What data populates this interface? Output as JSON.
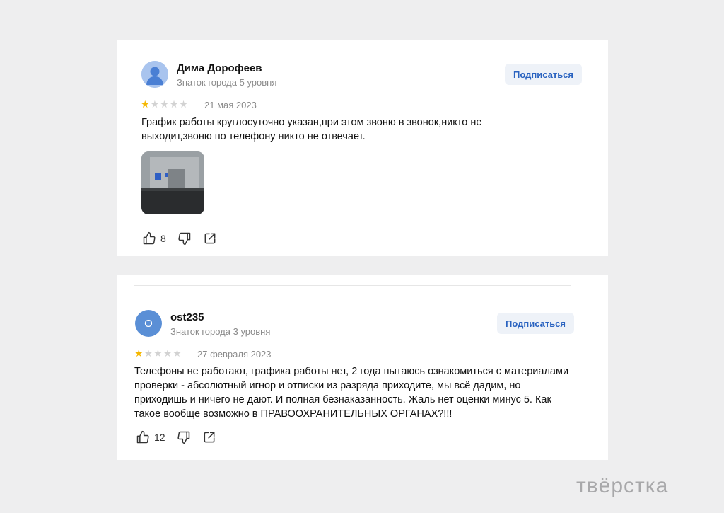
{
  "reviews": [
    {
      "author": "Дима Дорофеев",
      "level": "Знаток города 5 уровня",
      "subscribe_label": "Подписаться",
      "rating": 1,
      "date": "21 мая 2023",
      "text": "График работы круглосуточно указан,при этом звоню в звонок,никто не выходит,звоню по телефону никто не отвечает.",
      "likes": "8"
    },
    {
      "author": "ost235",
      "avatar_letter": "O",
      "level": "Знаток города 3 уровня",
      "subscribe_label": "Подписаться",
      "rating": 1,
      "date": "27 февраля 2023",
      "text": "Телефоны не работают, графика работы нет, 2 года пытаюсь ознакомиться с материалами проверки - абсолютный игнор и отписки из разряда приходите, мы всё дадим, но приходишь и ничего не дают. И полная безнаказанность. Жаль нет оценки минус 5. Как такое вообще возможно в ПРАВООХРАНИТЕЛЬНЫХ ОРГАНАХ?!!!",
      "likes": "12"
    }
  ],
  "watermark": "твёрстка",
  "colors": {
    "star": "#f5b700",
    "accent": "#2a63c0",
    "button_bg": "#eef2f8"
  },
  "icons": [
    "user-avatar-icon",
    "star-icon",
    "thumbs-up-icon",
    "thumbs-down-icon",
    "share-icon"
  ]
}
